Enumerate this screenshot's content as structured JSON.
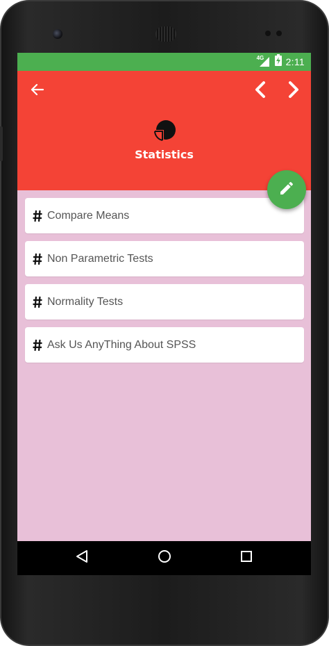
{
  "status_bar": {
    "network": "4G",
    "time": "2:11"
  },
  "header": {
    "title": "Statistics",
    "color": "#f44336",
    "icons": {
      "back": "arrow-back-icon",
      "prev": "chevron-left-icon",
      "next": "chevron-right-icon",
      "logo": "pie-chart-icon"
    }
  },
  "fab": {
    "icon": "pencil-icon",
    "color": "#4caf50"
  },
  "list": {
    "items": [
      {
        "icon": "hash-icon",
        "label": "Compare Means"
      },
      {
        "icon": "hash-icon",
        "label": "Non Parametric Tests"
      },
      {
        "icon": "hash-icon",
        "label": "Normality Tests"
      },
      {
        "icon": "hash-icon",
        "label": "Ask Us AnyThing About SPSS"
      }
    ]
  },
  "nav_bar": {
    "icons": [
      "back-triangle-icon",
      "home-circle-icon",
      "recents-square-icon"
    ]
  },
  "colors": {
    "status_bar": "#4caf50",
    "content_background": "#e8c0d8"
  }
}
